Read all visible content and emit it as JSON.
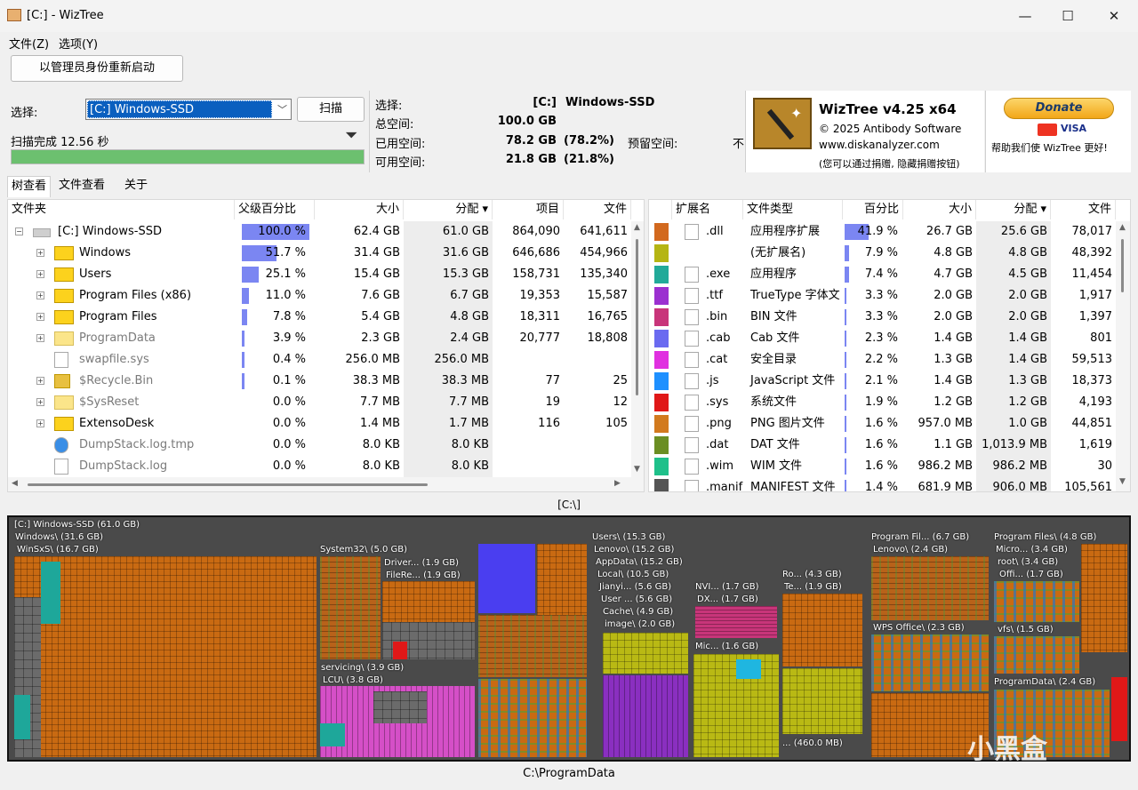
{
  "window": {
    "title": "[C:]  - WizTree",
    "minimize": "—",
    "maximize": "☐",
    "close": "✕"
  },
  "menu": {
    "file": "文件(Z)",
    "options": "选项(Y)"
  },
  "toolbar": {
    "restart_admin": "以管理员身份重新启动"
  },
  "scan": {
    "select_label": "选择:",
    "drive_value": "[C:] Windows-SSD",
    "scan_button": "扫描",
    "status": "扫描完成 12.56 秒",
    "progress": 1.0
  },
  "drive_info": {
    "select_label": "选择:",
    "drive_letter": "[C:]",
    "drive_name": "Windows-SSD",
    "total_label": "总空间:",
    "total_value": "100.0 GB",
    "used_label": "已用空间:",
    "used_value": "78.2 GB",
    "used_pct": "(78.2%)",
    "reserved_label": "预留空间:",
    "reserved_value": "不",
    "free_label": "可用空间:",
    "free_value": "21.8 GB",
    "free_pct": "(21.8%)"
  },
  "about": {
    "name": "WizTree v4.25 x64",
    "copyright": "© 2025 Antibody Software",
    "url": "www.diskanalyzer.com",
    "note": "(您可以通过捐赠, 隐藏捐赠按钮)",
    "donate": "Donate",
    "cards": "VISA",
    "donate_caption": "帮助我们使 WizTree 更好!"
  },
  "tabs": [
    "树查看",
    "文件查看",
    "关于"
  ],
  "tree_table": {
    "columns": [
      "文件夹",
      "父级百分比",
      "大小",
      "分配 ▾",
      "项目",
      "文件"
    ],
    "rows": [
      {
        "name": "[C:] Windows-SSD",
        "pct": "100.0 %",
        "pct_value": 1.0,
        "size": "62.4 GB",
        "alloc": "61.0 GB",
        "items": "864,090",
        "files": "641,611",
        "level": 0,
        "icon": "drive-icon"
      },
      {
        "name": "Windows",
        "pct": "51.7 %",
        "pct_value": 0.517,
        "size": "31.4 GB",
        "alloc": "31.6 GB",
        "items": "646,686",
        "files": "454,966",
        "level": 1,
        "icon": "folder-icon"
      },
      {
        "name": "Users",
        "pct": "25.1 %",
        "pct_value": 0.251,
        "size": "15.4 GB",
        "alloc": "15.3 GB",
        "items": "158,731",
        "files": "135,340",
        "level": 1,
        "icon": "folder-icon"
      },
      {
        "name": "Program Files (x86)",
        "pct": "11.0 %",
        "pct_value": 0.11,
        "size": "7.6 GB",
        "alloc": "6.7 GB",
        "items": "19,353",
        "files": "15,587",
        "level": 1,
        "icon": "folder-icon"
      },
      {
        "name": "Program Files",
        "pct": "7.8 %",
        "pct_value": 0.078,
        "size": "5.4 GB",
        "alloc": "4.8 GB",
        "items": "18,311",
        "files": "16,765",
        "level": 1,
        "icon": "folder-icon"
      },
      {
        "name": "ProgramData",
        "pct": "3.9 %",
        "pct_value": 0.039,
        "size": "2.3 GB",
        "alloc": "2.4 GB",
        "items": "20,777",
        "files": "18,808",
        "level": 1,
        "icon": "folder-icon",
        "dim": true
      },
      {
        "name": "swapfile.sys",
        "pct": "0.4 %",
        "pct_value": 0.004,
        "size": "256.0 MB",
        "alloc": "256.0 MB",
        "items": "",
        "files": "",
        "level": 1,
        "icon": "system-file-icon",
        "dim": true
      },
      {
        "name": "$Recycle.Bin",
        "pct": "0.1 %",
        "pct_value": 0.001,
        "size": "38.3 MB",
        "alloc": "38.3 MB",
        "items": "77",
        "files": "25",
        "level": 1,
        "icon": "recycle-bin-icon",
        "dim": true
      },
      {
        "name": "$SysReset",
        "pct": "0.0 %",
        "pct_value": 0.0,
        "size": "7.7 MB",
        "alloc": "7.7 MB",
        "items": "19",
        "files": "12",
        "level": 1,
        "icon": "folder-icon",
        "dim": true
      },
      {
        "name": "ExtensoDesk",
        "pct": "0.0 %",
        "pct_value": 0.0,
        "size": "1.4 MB",
        "alloc": "1.7 MB",
        "items": "116",
        "files": "105",
        "level": 1,
        "icon": "folder-icon"
      },
      {
        "name": "DumpStack.log.tmp",
        "pct": "0.0 %",
        "pct_value": 0.0,
        "size": "8.0 KB",
        "alloc": "8.0 KB",
        "items": "",
        "files": "",
        "level": 1,
        "icon": "log-file-icon",
        "dim": true
      },
      {
        "name": "DumpStack.log",
        "pct": "0.0 %",
        "pct_value": 0.0,
        "size": "8.0 KB",
        "alloc": "8.0 KB",
        "items": "",
        "files": "",
        "level": 1,
        "icon": "text-file-icon",
        "dim": true
      }
    ]
  },
  "ext_table": {
    "columns": [
      "扩展名",
      "文件类型",
      "百分比",
      "大小",
      "分配 ▾",
      "文件"
    ],
    "rows": [
      {
        "color": "#d2691e",
        "ext": ".dll",
        "type": "应用程序扩展",
        "pct": "41.9 %",
        "pct_value": 0.419,
        "size": "26.7 GB",
        "alloc": "25.6 GB",
        "files": "78,017"
      },
      {
        "color": "#b5b513",
        "ext": "",
        "type": "(无扩展名)",
        "pct": "7.9 %",
        "pct_value": 0.079,
        "size": "4.8 GB",
        "alloc": "4.8 GB",
        "files": "48,392"
      },
      {
        "color": "#22aa99",
        "ext": ".exe",
        "type": "应用程序",
        "pct": "7.4 %",
        "pct_value": 0.074,
        "size": "4.7 GB",
        "alloc": "4.5 GB",
        "files": "11,454"
      },
      {
        "color": "#9b30d0",
        "ext": ".ttf",
        "type": "TrueType 字体文",
        "pct": "3.3 %",
        "pct_value": 0.033,
        "size": "2.0 GB",
        "alloc": "2.0 GB",
        "files": "1,917"
      },
      {
        "color": "#c8357a",
        "ext": ".bin",
        "type": "BIN 文件",
        "pct": "3.3 %",
        "pct_value": 0.033,
        "size": "2.0 GB",
        "alloc": "2.0 GB",
        "files": "1,397"
      },
      {
        "color": "#6a6af0",
        "ext": ".cab",
        "type": "Cab 文件",
        "pct": "2.3 %",
        "pct_value": 0.023,
        "size": "1.4 GB",
        "alloc": "1.4 GB",
        "files": "801"
      },
      {
        "color": "#e030e0",
        "ext": ".cat",
        "type": "安全目录",
        "pct": "2.2 %",
        "pct_value": 0.022,
        "size": "1.3 GB",
        "alloc": "1.4 GB",
        "files": "59,513"
      },
      {
        "color": "#1e90ff",
        "ext": ".js",
        "type": "JavaScript 文件",
        "pct": "2.1 %",
        "pct_value": 0.021,
        "size": "1.4 GB",
        "alloc": "1.3 GB",
        "files": "18,373"
      },
      {
        "color": "#e01818",
        "ext": ".sys",
        "type": "系统文件",
        "pct": "1.9 %",
        "pct_value": 0.019,
        "size": "1.2 GB",
        "alloc": "1.2 GB",
        "files": "4,193"
      },
      {
        "color": "#d27a1e",
        "ext": ".png",
        "type": "PNG 图片文件",
        "pct": "1.6 %",
        "pct_value": 0.016,
        "size": "957.0 MB",
        "alloc": "1.0 GB",
        "files": "44,851"
      },
      {
        "color": "#6b8e23",
        "ext": ".dat",
        "type": "DAT 文件",
        "pct": "1.6 %",
        "pct_value": 0.016,
        "size": "1.1 GB",
        "alloc": "1,013.9 MB",
        "files": "1,619"
      },
      {
        "color": "#1fc08a",
        "ext": ".wim",
        "type": "WIM 文件",
        "pct": "1.6 %",
        "pct_value": 0.016,
        "size": "986.2 MB",
        "alloc": "986.2 MB",
        "files": "30"
      },
      {
        "color": "#555555",
        "ext": ".manif",
        "type": "MANIFEST 文件",
        "pct": "1.4 %",
        "pct_value": 0.014,
        "size": "681.9 MB",
        "alloc": "906.0 MB",
        "files": "105,561"
      }
    ]
  },
  "treemap_path": "[C:\\]",
  "treemap_labels": {
    "root": "[C:] Windows-SSD (61.0 GB)",
    "windows": "Windows\\ (31.6 GB)",
    "winsxs": "WinSxS\\ (16.7 GB)",
    "system32": "System32\\ (5.0 GB)",
    "driver": "Driver... (1.9 GB)",
    "filere": "FileRe... (1.9 GB)",
    "servicing": "servicing\\ (3.9 GB)",
    "lcu": "LCU\\ (3.8 GB)",
    "users": "Users\\ (15.3 GB)",
    "lenovo": "Lenovo\\ (15.2 GB)",
    "appdata": "AppData\\ (15.2 GB)",
    "local": "Local\\ (10.5 GB)",
    "jianyi": "Jianyi... (5.6 GB)",
    "user": "User ... (5.6 GB)",
    "cache": "Cache\\ (4.9 GB)",
    "image": "image\\ (2.0 GB)",
    "nvi": "NVI... (1.7 GB)",
    "dx": "DX... (1.7 GB)",
    "mic": "Mic... (1.6 GB)",
    "ro": "Ro... (4.3 GB)",
    "te": "Te... (1.9 GB)",
    "small": "... (460.0 MB)",
    "pfx86": "Program Fil... (6.7 GB)",
    "lenovo2": "Lenovo\\ (2.4 GB)",
    "wps": "WPS Office\\ (2.3 GB)",
    "pf": "Program Files\\ (4.8 GB)",
    "micro": "Micro... (3.4 GB)",
    "rootd": "root\\ (3.4 GB)",
    "offi": "Offi... (1.7 GB)",
    "vfs": "vfs\\ (1.5 GB)",
    "pdata": "ProgramData\\ (2.4 GB)"
  },
  "statusbar": "C:\\ProgramData",
  "watermark": "小黑盒"
}
